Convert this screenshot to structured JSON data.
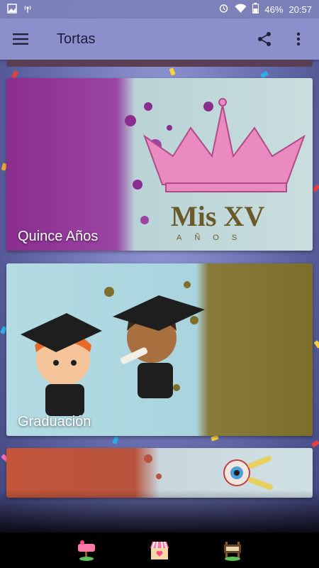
{
  "status_bar": {
    "battery": "46%",
    "time": "20:57",
    "icons": [
      "image-icon",
      "hotspot-icon",
      "alarm-icon",
      "wifi-icon",
      "battery-icon"
    ]
  },
  "app_bar": {
    "title": "Tortas",
    "menu_icon": "hamburger-menu-icon",
    "share_icon": "share-icon",
    "overflow_icon": "more-vertical-icon"
  },
  "cards": [
    {
      "label": "Quince Años",
      "image": "crown-mis-xv-image"
    },
    {
      "label": "Graduación",
      "image": "graduates-image"
    },
    {
      "label": "",
      "image": "eyeball-cake-image"
    }
  ],
  "bottom_nav": {
    "items": [
      "sign-icon",
      "shop-icon",
      "board-icon"
    ]
  },
  "colors": {
    "app_bar": "#8b90cc",
    "status_bar": "#7d82b9",
    "bottom_nav": "#000000"
  }
}
